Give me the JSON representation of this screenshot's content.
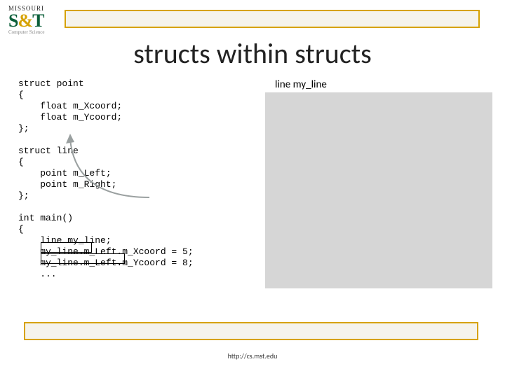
{
  "logo": {
    "line1": "MISSOURI",
    "line2_left": "S",
    "line2_amp": "&",
    "line2_right": "T",
    "line3": "Computer Science"
  },
  "title": "structs within structs",
  "code_block": "struct point\n{\n    float m_Xcoord;\n    float m_Ycoord;\n};\n\nstruct line\n{\n    point m_Left;\n    point m_Right;\n};\n\nint main()\n{\n    line my_line;\n    my_line.m_Left.m_Xcoord = 5;\n    my_line.m_Left.m_Ycoord = 8;\n    ...",
  "right_label": "line my_line",
  "footer": "http://cs.mst.edu"
}
